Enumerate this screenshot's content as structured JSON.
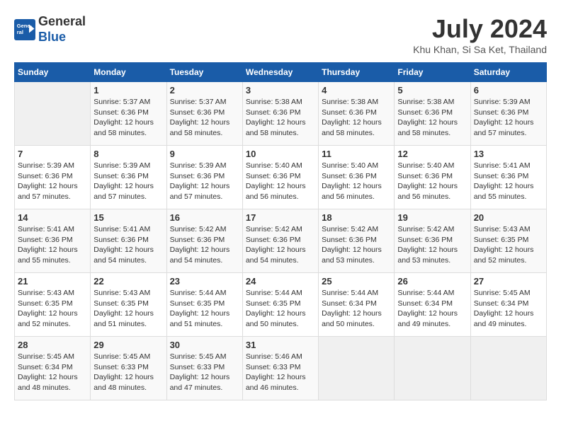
{
  "header": {
    "logo_line1": "General",
    "logo_line2": "Blue",
    "month_year": "July 2024",
    "location": "Khu Khan, Si Sa Ket, Thailand"
  },
  "days_of_week": [
    "Sunday",
    "Monday",
    "Tuesday",
    "Wednesday",
    "Thursday",
    "Friday",
    "Saturday"
  ],
  "weeks": [
    [
      {
        "day": "",
        "info": ""
      },
      {
        "day": "1",
        "info": "Sunrise: 5:37 AM\nSunset: 6:36 PM\nDaylight: 12 hours\nand 58 minutes."
      },
      {
        "day": "2",
        "info": "Sunrise: 5:37 AM\nSunset: 6:36 PM\nDaylight: 12 hours\nand 58 minutes."
      },
      {
        "day": "3",
        "info": "Sunrise: 5:38 AM\nSunset: 6:36 PM\nDaylight: 12 hours\nand 58 minutes."
      },
      {
        "day": "4",
        "info": "Sunrise: 5:38 AM\nSunset: 6:36 PM\nDaylight: 12 hours\nand 58 minutes."
      },
      {
        "day": "5",
        "info": "Sunrise: 5:38 AM\nSunset: 6:36 PM\nDaylight: 12 hours\nand 58 minutes."
      },
      {
        "day": "6",
        "info": "Sunrise: 5:39 AM\nSunset: 6:36 PM\nDaylight: 12 hours\nand 57 minutes."
      }
    ],
    [
      {
        "day": "7",
        "info": "Sunrise: 5:39 AM\nSunset: 6:36 PM\nDaylight: 12 hours\nand 57 minutes."
      },
      {
        "day": "8",
        "info": "Sunrise: 5:39 AM\nSunset: 6:36 PM\nDaylight: 12 hours\nand 57 minutes."
      },
      {
        "day": "9",
        "info": "Sunrise: 5:39 AM\nSunset: 6:36 PM\nDaylight: 12 hours\nand 57 minutes."
      },
      {
        "day": "10",
        "info": "Sunrise: 5:40 AM\nSunset: 6:36 PM\nDaylight: 12 hours\nand 56 minutes."
      },
      {
        "day": "11",
        "info": "Sunrise: 5:40 AM\nSunset: 6:36 PM\nDaylight: 12 hours\nand 56 minutes."
      },
      {
        "day": "12",
        "info": "Sunrise: 5:40 AM\nSunset: 6:36 PM\nDaylight: 12 hours\nand 56 minutes."
      },
      {
        "day": "13",
        "info": "Sunrise: 5:41 AM\nSunset: 6:36 PM\nDaylight: 12 hours\nand 55 minutes."
      }
    ],
    [
      {
        "day": "14",
        "info": "Sunrise: 5:41 AM\nSunset: 6:36 PM\nDaylight: 12 hours\nand 55 minutes."
      },
      {
        "day": "15",
        "info": "Sunrise: 5:41 AM\nSunset: 6:36 PM\nDaylight: 12 hours\nand 54 minutes."
      },
      {
        "day": "16",
        "info": "Sunrise: 5:42 AM\nSunset: 6:36 PM\nDaylight: 12 hours\nand 54 minutes."
      },
      {
        "day": "17",
        "info": "Sunrise: 5:42 AM\nSunset: 6:36 PM\nDaylight: 12 hours\nand 54 minutes."
      },
      {
        "day": "18",
        "info": "Sunrise: 5:42 AM\nSunset: 6:36 PM\nDaylight: 12 hours\nand 53 minutes."
      },
      {
        "day": "19",
        "info": "Sunrise: 5:42 AM\nSunset: 6:36 PM\nDaylight: 12 hours\nand 53 minutes."
      },
      {
        "day": "20",
        "info": "Sunrise: 5:43 AM\nSunset: 6:35 PM\nDaylight: 12 hours\nand 52 minutes."
      }
    ],
    [
      {
        "day": "21",
        "info": "Sunrise: 5:43 AM\nSunset: 6:35 PM\nDaylight: 12 hours\nand 52 minutes."
      },
      {
        "day": "22",
        "info": "Sunrise: 5:43 AM\nSunset: 6:35 PM\nDaylight: 12 hours\nand 51 minutes."
      },
      {
        "day": "23",
        "info": "Sunrise: 5:44 AM\nSunset: 6:35 PM\nDaylight: 12 hours\nand 51 minutes."
      },
      {
        "day": "24",
        "info": "Sunrise: 5:44 AM\nSunset: 6:35 PM\nDaylight: 12 hours\nand 50 minutes."
      },
      {
        "day": "25",
        "info": "Sunrise: 5:44 AM\nSunset: 6:34 PM\nDaylight: 12 hours\nand 50 minutes."
      },
      {
        "day": "26",
        "info": "Sunrise: 5:44 AM\nSunset: 6:34 PM\nDaylight: 12 hours\nand 49 minutes."
      },
      {
        "day": "27",
        "info": "Sunrise: 5:45 AM\nSunset: 6:34 PM\nDaylight: 12 hours\nand 49 minutes."
      }
    ],
    [
      {
        "day": "28",
        "info": "Sunrise: 5:45 AM\nSunset: 6:34 PM\nDaylight: 12 hours\nand 48 minutes."
      },
      {
        "day": "29",
        "info": "Sunrise: 5:45 AM\nSunset: 6:33 PM\nDaylight: 12 hours\nand 48 minutes."
      },
      {
        "day": "30",
        "info": "Sunrise: 5:45 AM\nSunset: 6:33 PM\nDaylight: 12 hours\nand 47 minutes."
      },
      {
        "day": "31",
        "info": "Sunrise: 5:46 AM\nSunset: 6:33 PM\nDaylight: 12 hours\nand 46 minutes."
      },
      {
        "day": "",
        "info": ""
      },
      {
        "day": "",
        "info": ""
      },
      {
        "day": "",
        "info": ""
      }
    ]
  ]
}
